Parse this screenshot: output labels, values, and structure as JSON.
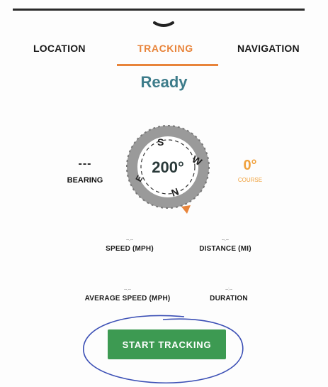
{
  "tabs": [
    {
      "label": "LOCATION"
    },
    {
      "label": "TRACKING"
    },
    {
      "label": "NAVIGATION"
    }
  ],
  "status": "Ready",
  "bearing": {
    "value": "---",
    "label": "BEARING"
  },
  "compass": {
    "heading": "200°",
    "n": "N",
    "s": "S",
    "e": "E",
    "w": "W"
  },
  "course": {
    "value": "0°",
    "label": "COURSE"
  },
  "stats": {
    "speed": {
      "value": "--.--",
      "label": "SPEED (MPH)"
    },
    "distance": {
      "value": "--.--",
      "label": "DISTANCE (MI)"
    },
    "avg_speed": {
      "value": "--.--",
      "label": "AVERAGE SPEED (MPH)"
    },
    "duration": {
      "value": "--:--",
      "label": "DURATION"
    }
  },
  "start_button": {
    "label": "START TRACKING"
  },
  "colors": {
    "accent": "#e8843a",
    "status": "#3d7c8a",
    "button": "#3d9a52",
    "course": "#f0a13c",
    "annotation": "#3b4fb5"
  }
}
